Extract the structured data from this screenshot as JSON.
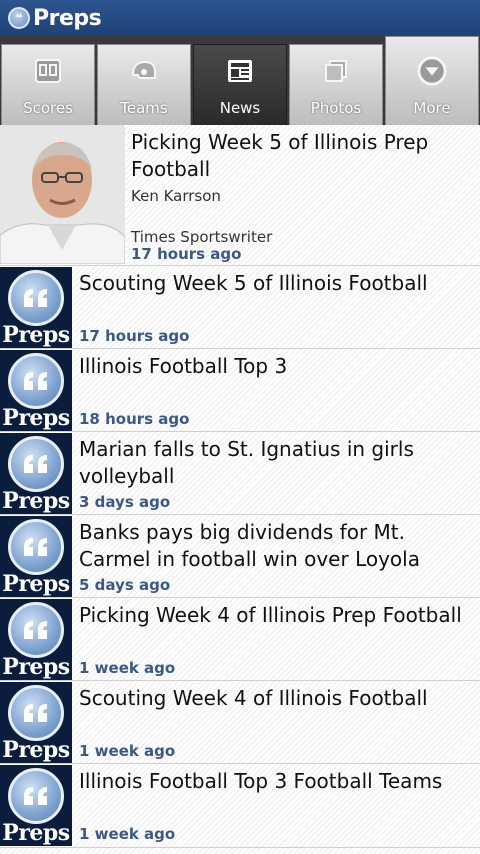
{
  "app": {
    "title": "Preps"
  },
  "tabs": [
    {
      "label": "Scores",
      "icon": "scoreboard-icon",
      "active": false
    },
    {
      "label": "Teams",
      "icon": "helmet-icon",
      "active": false
    },
    {
      "label": "News",
      "icon": "newspaper-icon",
      "active": true
    },
    {
      "label": "Photos",
      "icon": "photos-icon",
      "active": false
    },
    {
      "label": "More",
      "icon": "chevron-down-icon",
      "active": false
    }
  ],
  "feed": {
    "thumb_text": "Preps",
    "items": [
      {
        "title": "Picking Week 5 of Illinois Prep Football",
        "author": "Ken Karrson",
        "role": "Times Sportswriter",
        "time": "17 hours ago"
      },
      {
        "title": "Scouting Week 5 of Illinois Football",
        "time": "17 hours ago"
      },
      {
        "title": "Illinois Football Top 3",
        "time": "18 hours ago"
      },
      {
        "title": "Marian falls to St. Ignatius in girls volleyball",
        "time": "3 days ago"
      },
      {
        "title": "Banks pays big dividends for Mt. Carmel in football win over Loyola",
        "time": "5 days ago"
      },
      {
        "title": "Picking Week 4 of Illinois Prep Football",
        "time": "1 week ago"
      },
      {
        "title": "Scouting Week 4 of Illinois Football",
        "time": "1 week ago"
      },
      {
        "title": "Illinois Football Top 3 Football Teams",
        "time": "1 week ago"
      }
    ]
  },
  "colors": {
    "header": "#2e5590",
    "time": "#3b5888",
    "thumb_bg": "#0b1d3d"
  }
}
